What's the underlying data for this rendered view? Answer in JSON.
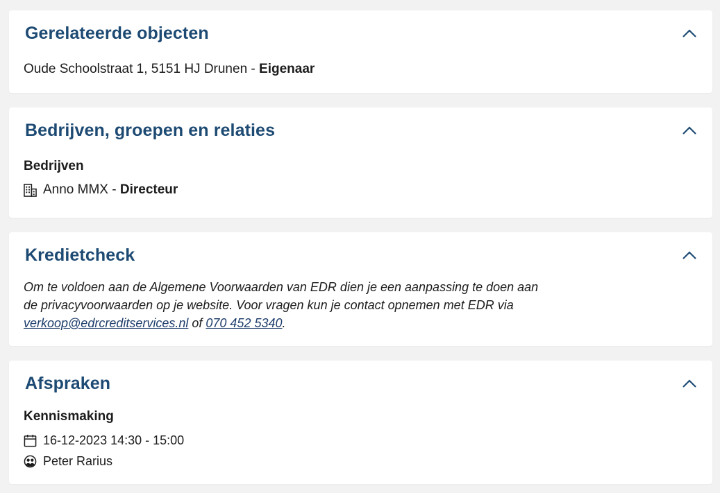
{
  "colors": {
    "title": "#1d4a73",
    "link": "#1d3d6b",
    "card_bg": "#ffffff",
    "page_bg": "#f2f2f3"
  },
  "related_objects": {
    "title": "Gerelateerde objecten",
    "address": "Oude Schoolstraat 1, 5151 HJ Drunen",
    "separator": " - ",
    "role": "Eigenaar"
  },
  "companies": {
    "title": "Bedrijven, groepen en relaties",
    "subheading": "Bedrijven",
    "item_name": "Anno MMX",
    "separator": " - ",
    "item_role": "Directeur",
    "item_icon": "building-icon"
  },
  "credit_check": {
    "title": "Kredietcheck",
    "text_line1": "Om te voldoen aan de Algemene Voorwaarden van EDR dien je een aanpassing te doen aan",
    "text_line2": "de privacyvoorwaarden op je website. Voor vragen kun je contact opnemen met EDR via",
    "email": "verkoop@edrcreditservices.nl",
    "or": " of ",
    "phone": "070 452 5340",
    "end": "."
  },
  "appointments": {
    "title": "Afspraken",
    "name": "Kennismaking",
    "datetime": "16-12-2023 14:30 - 15:00",
    "person": "Peter Rarius",
    "date_icon": "calendar-icon",
    "person_icon": "users-icon"
  }
}
